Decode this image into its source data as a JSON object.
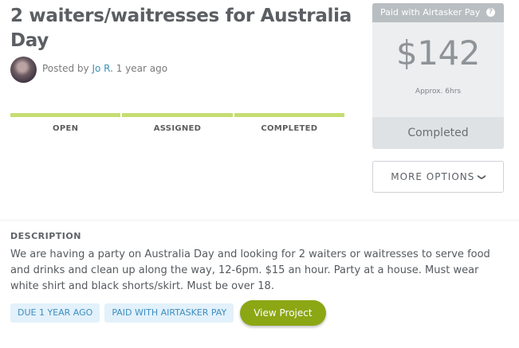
{
  "task": {
    "title": "2 waiters/waitresses for Australia Day",
    "posted_prefix": "Posted by ",
    "poster": "Jo R.",
    "posted_time": " 1 year ago"
  },
  "stages": [
    "OPEN",
    "ASSIGNED",
    "COMPLETED"
  ],
  "payment_panel": {
    "header": "Paid with Airtasker Pay",
    "help_icon": "?",
    "price": "$142",
    "approx": "Approx. 6hrs",
    "status": "Completed"
  },
  "more_options": {
    "label": "MORE OPTIONS",
    "icon": "chevron-down-icon"
  },
  "description": {
    "label": "DESCRIPTION",
    "text": "We are having a party on Australia Day and looking for 2 waiters or waitresses to serve food and drinks and clean up along the way, 12-6pm. $15 an hour. Party at a house. Must wear white shirt and black shorts/skirt. Must be over 18."
  },
  "tags": [
    "DUE 1 YEAR AGO",
    "PAID WITH AIRTASKER PAY"
  ],
  "view_project": "View Project",
  "colors": {
    "progress": "#c6dd72",
    "tag_bg": "#e2f1fb",
    "tag_text": "#3e8dc0",
    "button": "#8ba714",
    "link": "#3d8fb0"
  }
}
